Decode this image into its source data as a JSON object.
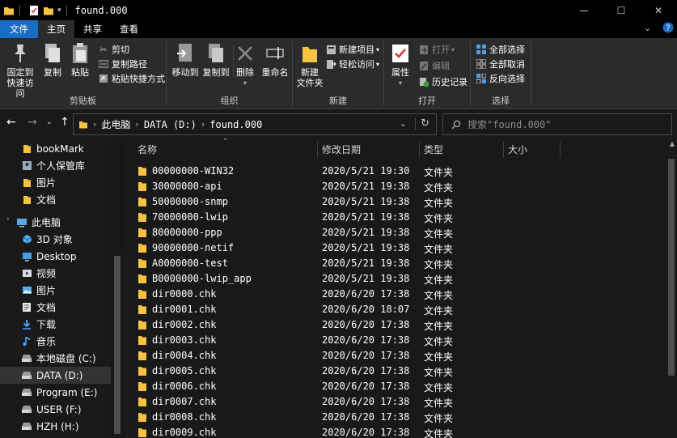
{
  "window": {
    "title": "found.000",
    "minimize": "—",
    "maximize": "☐",
    "close": "✕"
  },
  "ribbon_tabs": [
    "文件",
    "主页",
    "共享",
    "查看"
  ],
  "ribbon": {
    "clipboard": {
      "label": "剪贴板",
      "pin": "固定到\n快速访问",
      "copy": "复制",
      "paste": "粘贴",
      "cut": "剪切",
      "copy_path": "复制路径",
      "paste_shortcut": "粘贴快捷方式"
    },
    "organize": {
      "label": "组织",
      "move_to": "移动到",
      "copy_to": "复制到",
      "delete": "删除",
      "rename": "重命名"
    },
    "new": {
      "label": "新建",
      "new_folder": "新建\n文件夹",
      "new_item": "新建项目",
      "easy_access": "轻松访问"
    },
    "open": {
      "label": "打开",
      "properties": "属性",
      "open": "打开",
      "edit": "编辑",
      "history": "历史记录"
    },
    "select": {
      "label": "选择",
      "select_all": "全部选择",
      "select_none": "全部取消",
      "invert": "反向选择"
    }
  },
  "address": {
    "segments": [
      "此电脑",
      "DATA (D:)",
      "found.000"
    ],
    "search_placeholder": "搜索\"found.000\""
  },
  "nav_pane": [
    {
      "label": "bookMark",
      "icon": "folder-icon",
      "indent": 1
    },
    {
      "label": "个人保管库",
      "icon": "person-icon",
      "indent": 1
    },
    {
      "label": "图片",
      "icon": "folder-icon",
      "indent": 1
    },
    {
      "label": "文档",
      "icon": "folder-icon",
      "indent": 1
    },
    {
      "label": "此电脑",
      "icon": "computer-icon",
      "indent": 0
    },
    {
      "label": "3D 对象",
      "icon": "cube-icon",
      "indent": 1
    },
    {
      "label": "Desktop",
      "icon": "desktop-icon",
      "indent": 1
    },
    {
      "label": "视频",
      "icon": "video-icon",
      "indent": 1
    },
    {
      "label": "图片",
      "icon": "pictures-icon",
      "indent": 1
    },
    {
      "label": "文档",
      "icon": "documents-icon",
      "indent": 1
    },
    {
      "label": "下载",
      "icon": "download-icon",
      "indent": 1
    },
    {
      "label": "音乐",
      "icon": "music-icon",
      "indent": 1
    },
    {
      "label": "本地磁盘 (C:)",
      "icon": "drive-icon",
      "indent": 1
    },
    {
      "label": "DATA (D:)",
      "icon": "drive-icon",
      "indent": 1,
      "selected": true
    },
    {
      "label": "Program (E:)",
      "icon": "drive-icon",
      "indent": 1
    },
    {
      "label": "USER (F:)",
      "icon": "drive-icon",
      "indent": 1
    },
    {
      "label": "HZH (H:)",
      "icon": "drive-icon",
      "indent": 1
    }
  ],
  "columns": {
    "name": "名称",
    "date": "修改日期",
    "type": "类型",
    "size": "大小"
  },
  "files": [
    {
      "name": "00000000-WIN32",
      "date": "2020/5/21 19:30",
      "type": "文件夹"
    },
    {
      "name": "30000000-api",
      "date": "2020/5/21 19:38",
      "type": "文件夹"
    },
    {
      "name": "50000000-snmp",
      "date": "2020/5/21 19:38",
      "type": "文件夹"
    },
    {
      "name": "70000000-lwip",
      "date": "2020/5/21 19:38",
      "type": "文件夹"
    },
    {
      "name": "80000000-ppp",
      "date": "2020/5/21 19:38",
      "type": "文件夹"
    },
    {
      "name": "90000000-netif",
      "date": "2020/5/21 19:38",
      "type": "文件夹"
    },
    {
      "name": "A0000000-test",
      "date": "2020/5/21 19:38",
      "type": "文件夹"
    },
    {
      "name": "B0000000-lwip_app",
      "date": "2020/5/21 19:38",
      "type": "文件夹"
    },
    {
      "name": "dir0000.chk",
      "date": "2020/6/20 17:38",
      "type": "文件夹"
    },
    {
      "name": "dir0001.chk",
      "date": "2020/6/20 18:07",
      "type": "文件夹"
    },
    {
      "name": "dir0002.chk",
      "date": "2020/6/20 17:38",
      "type": "文件夹"
    },
    {
      "name": "dir0003.chk",
      "date": "2020/6/20 17:38",
      "type": "文件夹"
    },
    {
      "name": "dir0004.chk",
      "date": "2020/6/20 17:38",
      "type": "文件夹"
    },
    {
      "name": "dir0005.chk",
      "date": "2020/6/20 17:38",
      "type": "文件夹"
    },
    {
      "name": "dir0006.chk",
      "date": "2020/6/20 17:38",
      "type": "文件夹"
    },
    {
      "name": "dir0007.chk",
      "date": "2020/6/20 17:38",
      "type": "文件夹"
    },
    {
      "name": "dir0008.chk",
      "date": "2020/6/20 17:38",
      "type": "文件夹"
    },
    {
      "name": "dir0009.chk",
      "date": "2020/6/20 17:38",
      "type": "文件夹"
    }
  ],
  "colors": {
    "accent": "#1a6dc4",
    "folder": "#f6c343",
    "background": "#191919",
    "ribbon": "#2b2b2b"
  }
}
